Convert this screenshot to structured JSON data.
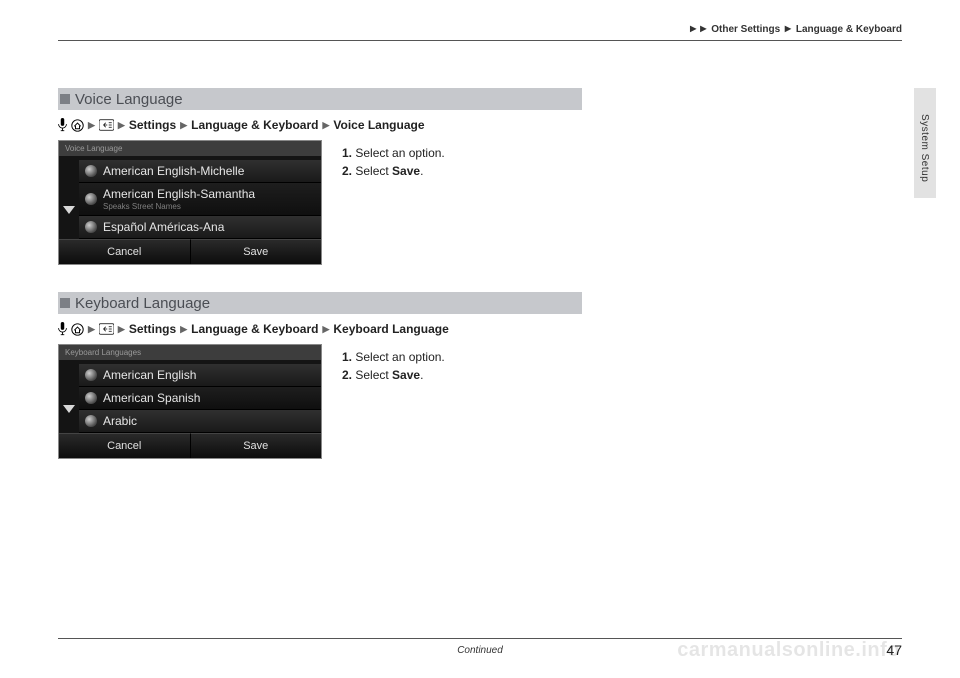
{
  "breadcrumb": {
    "parent": "Other Settings",
    "child": "Language & Keyboard"
  },
  "side_tab_label": "System Setup",
  "sections": {
    "voice": {
      "heading": "Voice Language",
      "path": {
        "settings": "Settings",
        "cat": "Language & Keyboard",
        "leaf": "Voice Language"
      },
      "screen_title": "Voice Language",
      "options": [
        {
          "label": "American English-Michelle",
          "sub": ""
        },
        {
          "label": "American English-Samantha",
          "sub": "Speaks Street Names"
        },
        {
          "label": "Español Américas-Ana",
          "sub": ""
        }
      ],
      "cancel": "Cancel",
      "save": "Save",
      "step1": "Select an option.",
      "step2a": "Select ",
      "step2b": "Save",
      "step2c": "."
    },
    "keyboard": {
      "heading": "Keyboard Language",
      "path": {
        "settings": "Settings",
        "cat": "Language & Keyboard",
        "leaf": "Keyboard Language"
      },
      "screen_title": "Keyboard Languages",
      "options": [
        {
          "label": "American English"
        },
        {
          "label": "American Spanish"
        },
        {
          "label": "Arabic"
        }
      ],
      "cancel": "Cancel",
      "save": "Save",
      "step1": "Select an option.",
      "step2a": "Select ",
      "step2b": "Save",
      "step2c": "."
    }
  },
  "footer": {
    "continued": "Continued",
    "page": "47"
  },
  "watermark": "carmanualsonline.info"
}
